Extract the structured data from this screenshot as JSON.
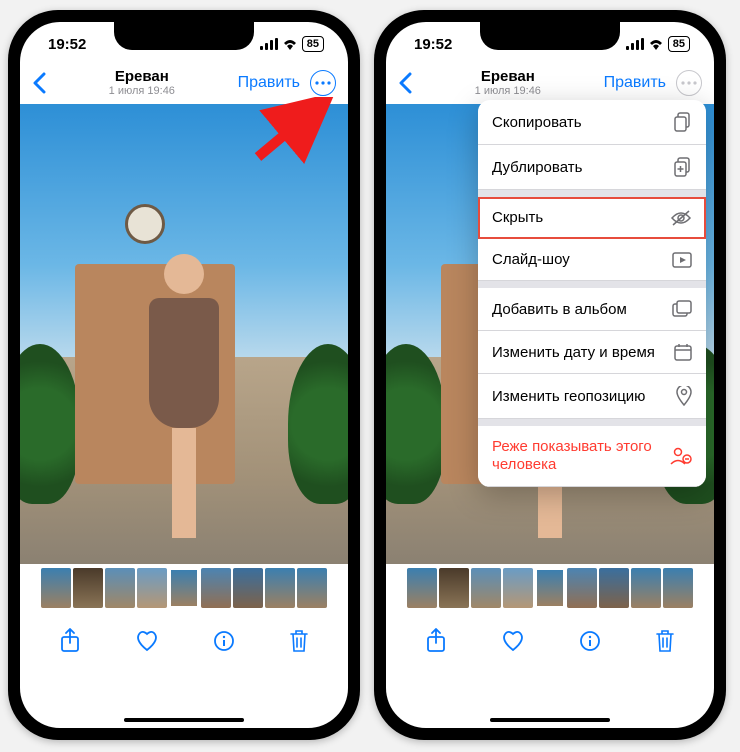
{
  "status": {
    "time": "19:52",
    "battery": "85"
  },
  "nav": {
    "title": "Ереван",
    "subtitle": "1 июля  19:46",
    "edit": "Править"
  },
  "menu": {
    "items": [
      {
        "label": "Скопировать",
        "icon": "copy"
      },
      {
        "label": "Дублировать",
        "icon": "duplicate"
      },
      {
        "label": "Скрыть",
        "icon": "hide",
        "highlight": true
      },
      {
        "label": "Слайд-шоу",
        "icon": "slideshow"
      },
      {
        "label": "Добавить в альбом",
        "icon": "add-album"
      },
      {
        "label": "Изменить дату и время",
        "icon": "calendar"
      },
      {
        "label": "Изменить геопозицию",
        "icon": "pin"
      },
      {
        "label": "Реже показывать этого человека",
        "icon": "person-minus",
        "destructive": true
      }
    ]
  }
}
